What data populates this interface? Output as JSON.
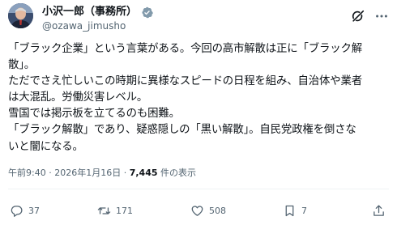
{
  "author": {
    "display_name": "小沢一郎（事務所）",
    "handle": "@ozawa_jimusho",
    "verified": true,
    "verified_color": "#829aab"
  },
  "post": {
    "lines": [
      "「ブラック企業」という言葉がある。今回の高市解散は正に「ブラック解",
      "散」。",
      "ただでさえ忙しいこの時期に異様なスピードの日程を組み、自治体や業者",
      "は大混乱。労働災害レベル。",
      "雪国では掲示板を立てるのも困難。",
      "「ブラック解散」であり、疑惑隠しの「黒い解散」。自民党政権を倒さな",
      "いと闇になる。"
    ]
  },
  "meta": {
    "time": "午前9:40",
    "separator": "·",
    "date": "2026年1月16日",
    "views_count": "7,445",
    "views_label": "件の表示"
  },
  "actions": {
    "replies": "37",
    "reposts": "171",
    "likes": "508",
    "bookmarks": "7"
  },
  "icons": {
    "verified": "verified-badge-icon",
    "grok": "grok-icon",
    "more": "more-options-icon",
    "reply": "reply-icon",
    "repost": "repost-icon",
    "like": "heart-icon",
    "bookmark": "bookmark-icon",
    "share": "share-icon"
  },
  "colors": {
    "text": "#0f1419",
    "secondary": "#536471",
    "divider": "#eff3f4"
  }
}
